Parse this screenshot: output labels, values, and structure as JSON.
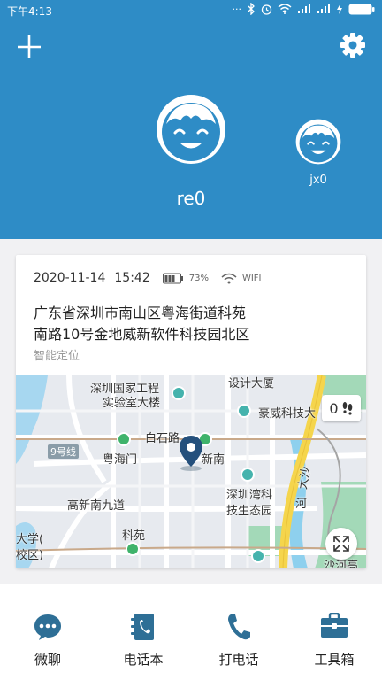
{
  "status_bar": {
    "time": "下午4:13",
    "dots": "···"
  },
  "header": {
    "main_member": {
      "name": "re0"
    },
    "other_member": {
      "name": "jx0"
    }
  },
  "location_card": {
    "date": "2020-11-14",
    "time": "15:42",
    "battery": "73%",
    "network": "WIFI",
    "address_line1": "广东省深圳市南山区粤海街道科苑",
    "address_line2": "南路10号金地威新软件科技园北区",
    "location_type": "智能定位"
  },
  "map": {
    "labels": {
      "lab": "深圳国家工程",
      "lab2": "实验室大楼",
      "design": "设计大厦",
      "haowei": "豪威科技大",
      "baishi": "白石路",
      "yuehaimen": "粤海门",
      "xinnan": "新南",
      "line9": "9号线",
      "bay": "深圳湾科",
      "bay2": "技生态园",
      "dasha": "大沙",
      "river": "河",
      "gaoxin": "高新南九道",
      "keyuan": "科苑",
      "daxue": "大学(",
      "xiaoqu": "校区)",
      "shahe": "沙河高"
    },
    "steps": "0"
  },
  "bottom_nav": [
    {
      "label": "微聊"
    },
    {
      "label": "电话本"
    },
    {
      "label": "打电话"
    },
    {
      "label": "工具箱"
    }
  ],
  "colors": {
    "primary": "#2e8cc6",
    "map_teal": "#45b3ad",
    "road_yellow": "#f5d54c"
  }
}
